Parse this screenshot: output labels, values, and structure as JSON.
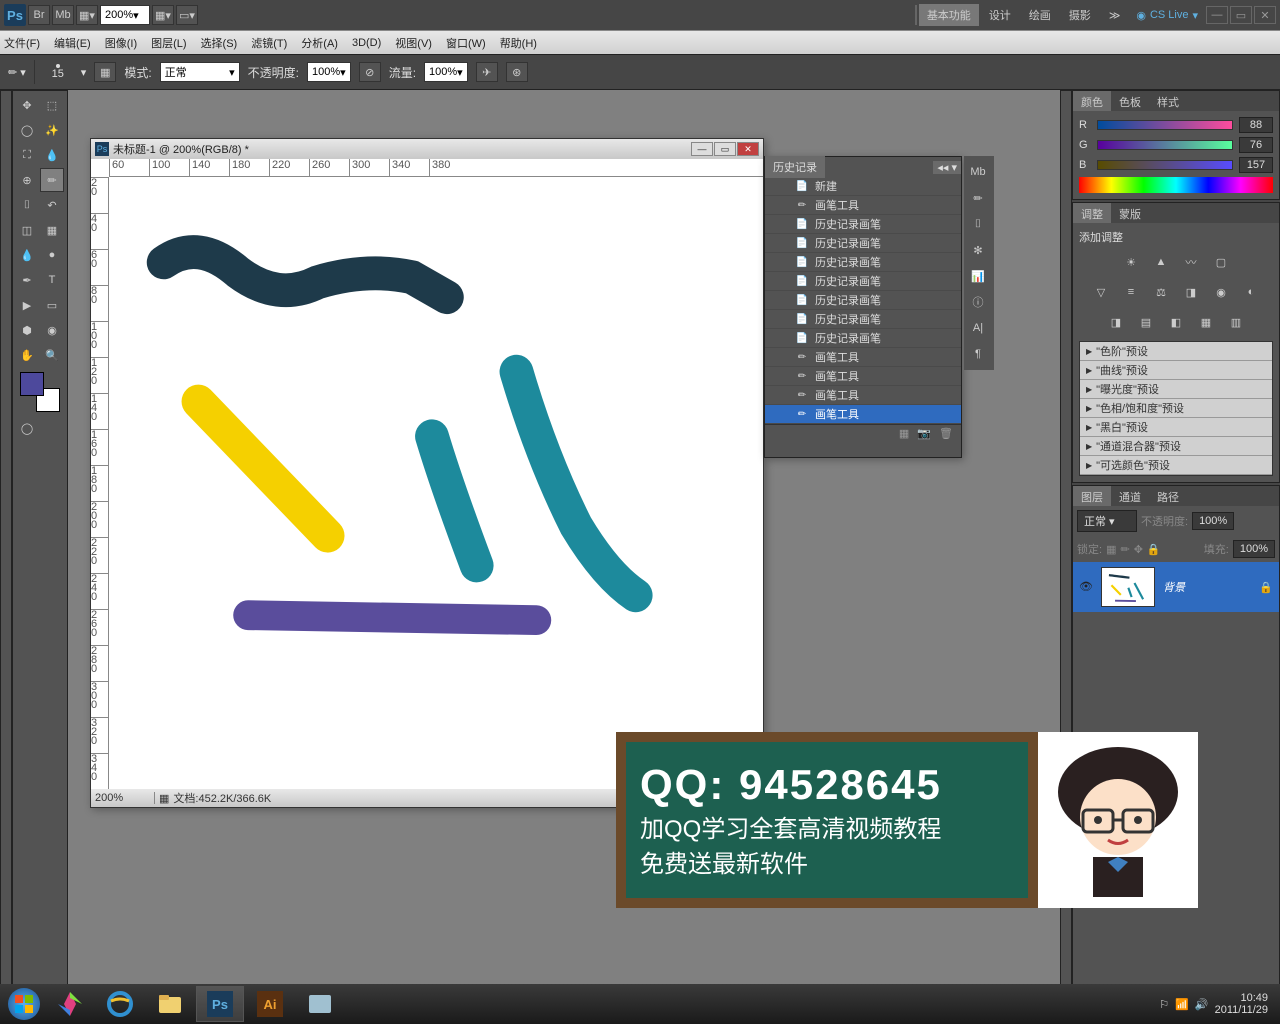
{
  "topbar": {
    "zoom": "200%"
  },
  "tabs": {
    "basic": "基本功能",
    "design": "设计",
    "paint": "绘画",
    "photo": "摄影"
  },
  "cslive": "CS Live",
  "menu": {
    "file": "文件(F)",
    "edit": "编辑(E)",
    "image": "图像(I)",
    "layer": "图层(L)",
    "select": "选择(S)",
    "filter": "滤镜(T)",
    "analysis": "分析(A)",
    "3d": "3D(D)",
    "view": "视图(V)",
    "window": "窗口(W)",
    "help": "帮助(H)"
  },
  "optbar": {
    "brushSize": "15",
    "mode": "模式:",
    "modeVal": "正常",
    "opacity": "不透明度:",
    "opacityVal": "100%",
    "flow": "流量:",
    "flowVal": "100%"
  },
  "doc": {
    "title": "未标题-1 @ 200%(RGB/8) *",
    "zoom": "200%",
    "fileinfo": "文档:452.2K/366.6K"
  },
  "rulerH": [
    "60",
    "100",
    "140",
    "180",
    "220",
    "260",
    "300",
    "340",
    "380"
  ],
  "rulerV": [
    "20",
    "40",
    "60",
    "80",
    "100",
    "120",
    "140",
    "160",
    "180",
    "200",
    "220",
    "240",
    "260",
    "280",
    "300",
    "320",
    "340"
  ],
  "history": {
    "title": "历史记录",
    "items": [
      {
        "icon": "📄",
        "label": "新建"
      },
      {
        "icon": "✏",
        "label": "画笔工具"
      },
      {
        "icon": "📄",
        "label": "历史记录画笔"
      },
      {
        "icon": "📄",
        "label": "历史记录画笔"
      },
      {
        "icon": "📄",
        "label": "历史记录画笔"
      },
      {
        "icon": "📄",
        "label": "历史记录画笔"
      },
      {
        "icon": "📄",
        "label": "历史记录画笔"
      },
      {
        "icon": "📄",
        "label": "历史记录画笔"
      },
      {
        "icon": "📄",
        "label": "历史记录画笔"
      },
      {
        "icon": "✏",
        "label": "画笔工具"
      },
      {
        "icon": "✏",
        "label": "画笔工具"
      },
      {
        "icon": "✏",
        "label": "画笔工具"
      },
      {
        "icon": "✏",
        "label": "画笔工具",
        "sel": true
      }
    ]
  },
  "colorTabs": {
    "color": "颜色",
    "swatch": "色板",
    "style": "样式"
  },
  "rgb": {
    "r": "R",
    "rVal": "88",
    "g": "G",
    "gVal": "76",
    "b": "B",
    "bVal": "157"
  },
  "adjTabs": {
    "adj": "调整",
    "mask": "蒙版"
  },
  "adjTitle": "添加调整",
  "presets": [
    "\"色阶\"预设",
    "\"曲线\"预设",
    "\"曝光度\"预设",
    "\"色相/饱和度\"预设",
    "\"黑白\"预设",
    "\"通道混合器\"预设",
    "\"可选颜色\"预设"
  ],
  "layerTabs": {
    "layers": "图层",
    "channels": "通道",
    "paths": "路径"
  },
  "layerPanel": {
    "blend": "正常",
    "opacityLbl": "不透明度:",
    "opacityVal": "100%",
    "lockLbl": "锁定:",
    "fillLbl": "填充:",
    "fillVal": "100%"
  },
  "layerName": "背景",
  "promo": {
    "qq": "QQ: 94528645",
    "t1": "加QQ学习全套高清视频教程",
    "t2": "免费送最新软件"
  },
  "tray": {
    "time": "10:49",
    "date": "2011/11/29"
  }
}
